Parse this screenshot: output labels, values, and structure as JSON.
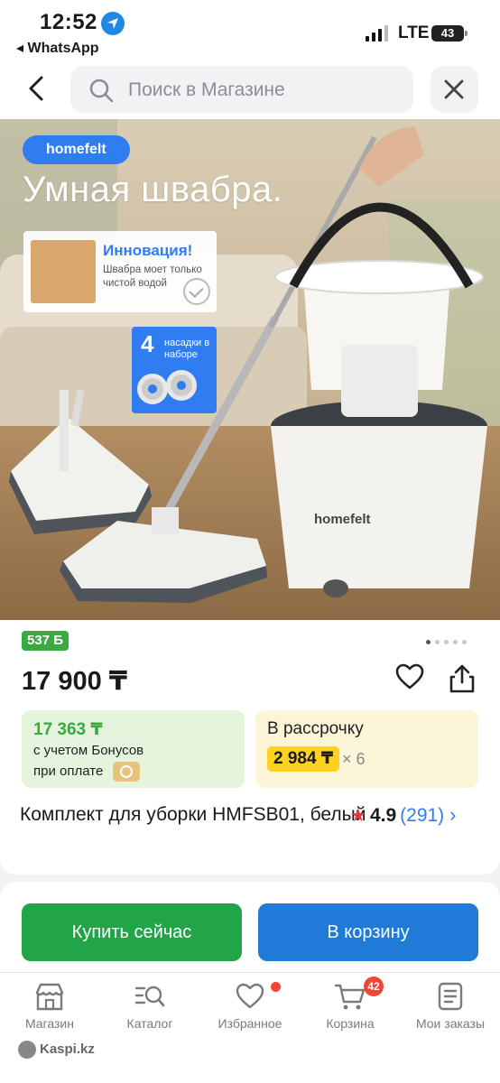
{
  "status_bar": {
    "time": "12:52",
    "back_to_app": "◂ WhatsApp",
    "network": "LTE",
    "battery": "43"
  },
  "search": {
    "placeholder": "Поиск в Магазине"
  },
  "product_image": {
    "brand_badge": "homefelt",
    "headline": "Умная швабра.",
    "innovation_title": "Инновация!",
    "innovation_text": "Швабра моет только чистой водой",
    "pads_count": "4",
    "pads_label": "насадки в наборе",
    "bucket_brand": "homefelt",
    "slides_total": 5,
    "slide_active": 1
  },
  "product": {
    "points": "537 Б",
    "price": "17 900 ₸",
    "bonus": {
      "price": "17 363 ₸",
      "line1": "с учетом Бонусов",
      "line2": "при оплате"
    },
    "installment": {
      "title": "В рассрочку",
      "price": "2 984 ₸",
      "multiplier": "× 6"
    },
    "title": "Комплект для уборки HMFSB01, белый",
    "rating": "4.9",
    "reviews": "(291)"
  },
  "actions": {
    "buy_now": "Купить сейчас",
    "add_to_cart": "В корзину"
  },
  "tabbar": {
    "items": [
      {
        "label": "Магазин",
        "icon": "store-icon"
      },
      {
        "label": "Каталог",
        "icon": "catalog-search-icon"
      },
      {
        "label": "Избранное",
        "icon": "heart-icon"
      },
      {
        "label": "Корзина",
        "icon": "cart-icon"
      },
      {
        "label": "Мои заказы",
        "icon": "orders-icon"
      }
    ],
    "cart_count": "42"
  },
  "footer_mark": "Kaspi.kz",
  "colors": {
    "accent_blue": "#1f7ad8",
    "buy_green": "#22a449",
    "bonus_green": "#3aa93f",
    "installment_yellow": "#ffd21f",
    "badge_red": "#f14635"
  }
}
